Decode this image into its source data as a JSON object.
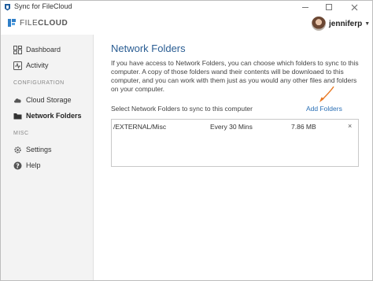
{
  "window": {
    "title": "Sync for FileCloud"
  },
  "header": {
    "logo_text_a": "FILE",
    "logo_text_b": "CLOUD",
    "username": "jenniferp"
  },
  "sidebar": {
    "items": [
      {
        "label": "Dashboard",
        "icon": "dashboard-icon"
      },
      {
        "label": "Activity",
        "icon": "activity-icon"
      },
      {
        "section": "CONFIGURATION"
      },
      {
        "label": "Cloud Storage",
        "icon": "cloud-icon"
      },
      {
        "label": "Network Folders",
        "icon": "network-folder-icon",
        "active": true
      },
      {
        "section": "MISC"
      },
      {
        "label": "Settings",
        "icon": "gear-icon"
      },
      {
        "label": "Help",
        "icon": "help-icon"
      }
    ]
  },
  "main": {
    "title": "Network Folders",
    "description": "If you have access to Network Folders, you can choose which folders to sync to this computer. A copy of those folders wand their contents will be downloaed to this computer, and you can work with them just as you would any other files and folders on your computer.",
    "select_text": "Select Network Folders to sync to this computer",
    "add_folders_label": "Add Folders",
    "folders": [
      {
        "path": "/EXTERNAL/Misc",
        "frequency": "Every 30 Mins",
        "size": "7.86 MB",
        "remove": "×"
      }
    ]
  },
  "colors": {
    "accent": "#2a5d93",
    "link": "#2a6fb5",
    "arrow": "#e87722",
    "sidebar_bg": "#f3f3f3"
  }
}
